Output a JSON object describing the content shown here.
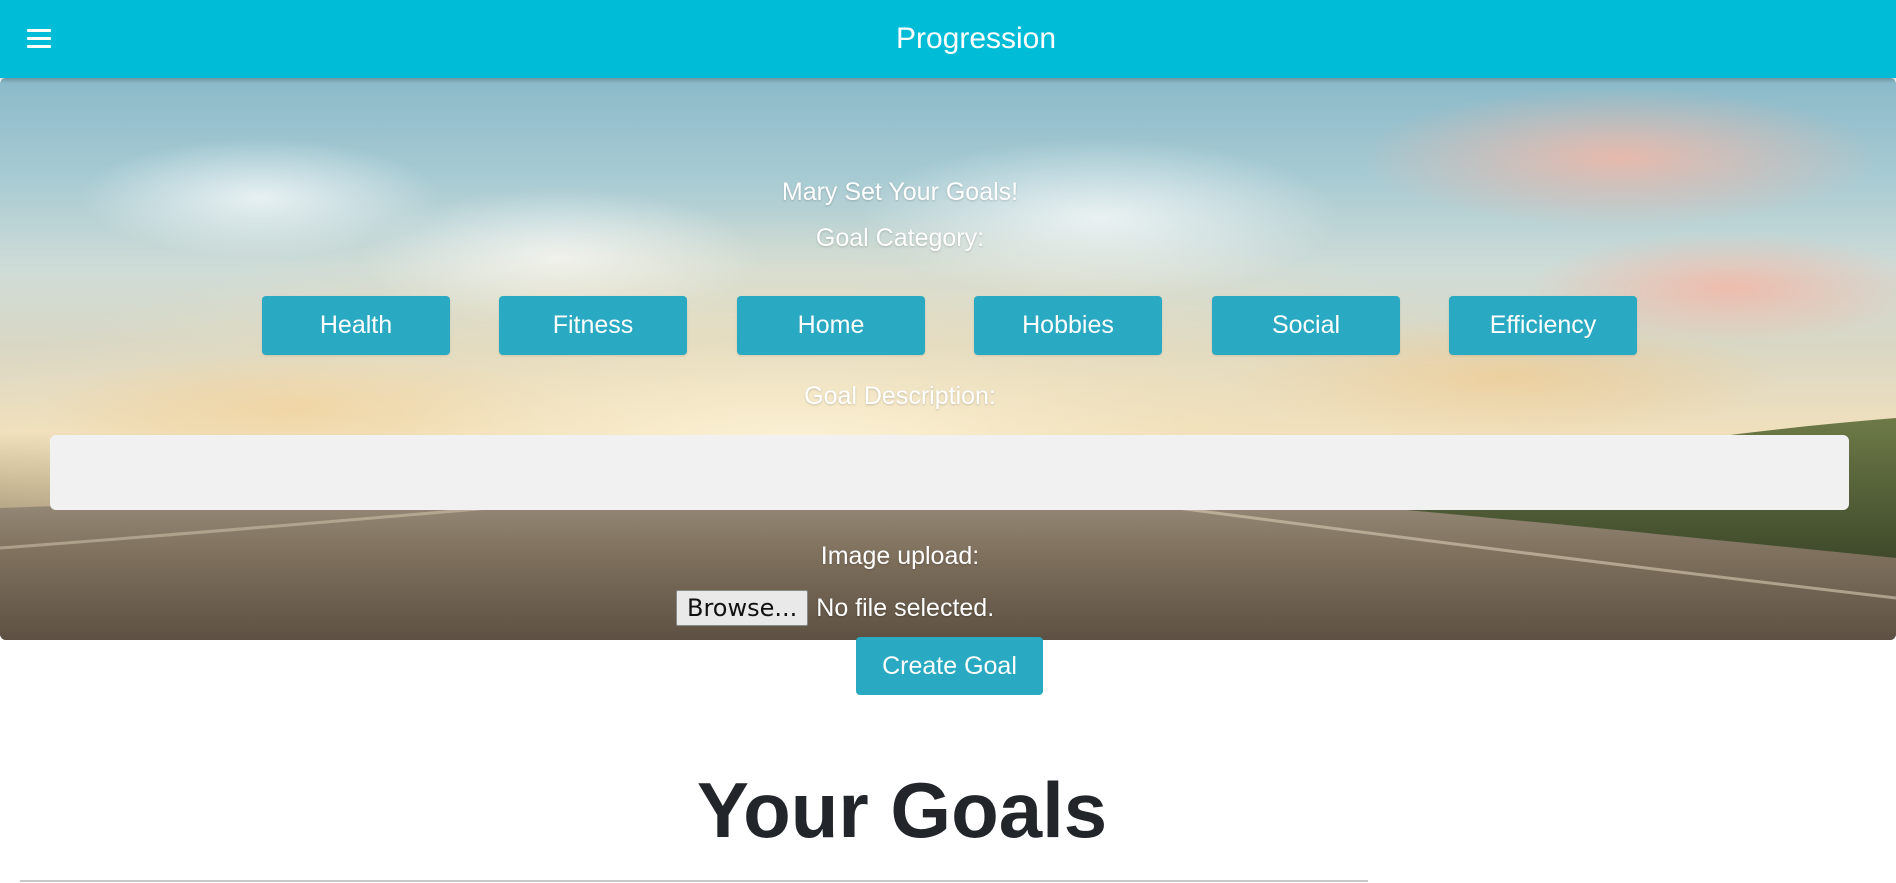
{
  "navbar": {
    "title": "Progression",
    "menu_icon": "hamburger-menu-icon",
    "background_color": "#00bcd6"
  },
  "form": {
    "welcome": "Mary Set Your Goals!",
    "category_label": "Goal Category:",
    "categories": [
      "Health",
      "Fitness",
      "Home",
      "Hobbies",
      "Social",
      "Efficiency"
    ],
    "description_label": "Goal Description:",
    "description_value": "",
    "upload_label": "Image upload:",
    "browse_label": "Browse...",
    "file_status": "No file selected.",
    "submit_label": "Create Goal",
    "button_color": "#2aa9c2"
  },
  "goals": {
    "title": "Your Goals"
  }
}
